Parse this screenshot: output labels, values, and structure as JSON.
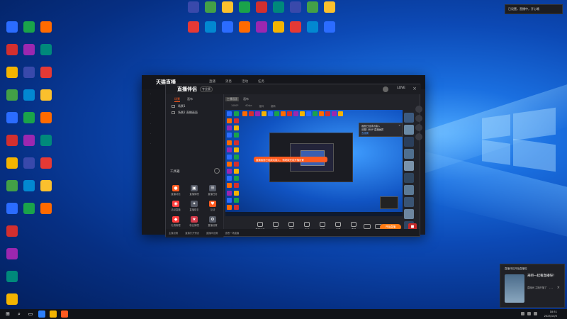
{
  "toast": {
    "text": "已设置，直播中，开心哦"
  },
  "app": {
    "brand": "天猫直播",
    "nav": [
      "直播",
      "消息",
      "活动",
      "任务"
    ]
  },
  "studio": {
    "title": "直播伴侣",
    "badge": "专业版",
    "user": "LOVE",
    "scene_tabs": [
      "场景",
      "画布"
    ],
    "scenes": [
      "场景1",
      "场景2 直播画面"
    ],
    "tools_title": "工具箱",
    "tools": [
      {
        "label": "直播动态",
        "color": "#ff5a1f",
        "glyph": "●"
      },
      {
        "label": "直播管理",
        "color": "#555a66",
        "glyph": "▣"
      },
      {
        "label": "直播任务",
        "color": "#555a66",
        "glyph": "☰"
      },
      {
        "label": "活动直播",
        "color": "#ff3d3d",
        "glyph": "◉"
      },
      {
        "label": "直播助手",
        "color": "#555a66",
        "glyph": "✦"
      },
      {
        "label": "互动",
        "color": "#ff5a1f",
        "glyph": "♥"
      },
      {
        "label": "礼物管理",
        "color": "#ff3d3d",
        "glyph": "◆"
      },
      {
        "label": "粉丝管理",
        "color": "#d23a4a",
        "glyph": "★"
      },
      {
        "label": "直播设置",
        "color": "#555a66",
        "glyph": "⚙"
      }
    ],
    "bottom_bar": [
      "主播设置",
      "直播打开预设",
      "直播间设置",
      "查看一场直播"
    ],
    "preview_tabs": [
      "主播画面",
      "画布"
    ],
    "controls": [
      "1080P",
      "60fps",
      "旋转",
      "翻转"
    ],
    "banner": "直播画面已经成功接入，请继续完成开播设置",
    "notice": {
      "line1": "画面已经成功接入",
      "line2": "设置1080P 直播画质",
      "link": "去设置"
    },
    "toolbar": [
      "直播画面",
      "画面",
      "弹幕",
      "互动",
      "礼物",
      "连麦",
      "直播"
    ],
    "live_label": "开始直播"
  },
  "notification": {
    "title": "直播伴侣开始直播啦",
    "body": "来吧一起看直播呀！",
    "sub": "直播间 主播开播了"
  },
  "taskbar": {
    "time": "18:51",
    "date": "2023/10/5"
  }
}
